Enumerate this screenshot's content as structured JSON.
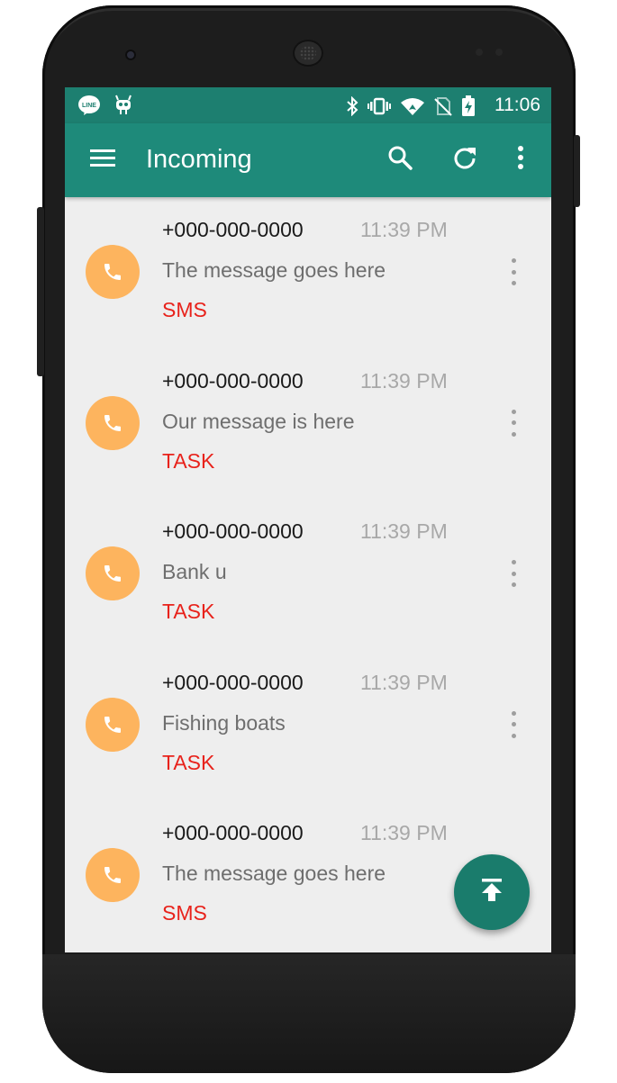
{
  "status_bar": {
    "time": "11:06",
    "left_icons": [
      "line-icon",
      "robot-icon"
    ],
    "right_icons": [
      "bluetooth-icon",
      "vibrate-icon",
      "wifi-icon",
      "no-sim-icon",
      "battery-charging-icon"
    ]
  },
  "app_bar": {
    "title": "Incoming",
    "color": "#1e8a7a",
    "icons": [
      "menu-icon",
      "search-icon",
      "refresh-icon",
      "more-vert-icon"
    ]
  },
  "messages": [
    {
      "number": "+000-000-0000",
      "time": "11:39 PM",
      "text": "The message goes here",
      "type": "SMS"
    },
    {
      "number": "+000-000-0000",
      "time": "11:39 PM",
      "text": "Our message is here",
      "type": "TASK"
    },
    {
      "number": "+000-000-0000",
      "time": "11:39 PM",
      "text": "Bank u",
      "type": "TASK"
    },
    {
      "number": "+000-000-0000",
      "time": "11:39 PM",
      "text": "Fishing boats",
      "type": "TASK"
    },
    {
      "number": "+000-000-0000",
      "time": "11:39 PM",
      "text": "The message goes here",
      "type": "SMS"
    }
  ],
  "colors": {
    "avatar": "#fdb45e",
    "type_label": "#e8221b",
    "fab": "#1a7c6c"
  },
  "fab": {
    "icon": "publish-icon"
  }
}
